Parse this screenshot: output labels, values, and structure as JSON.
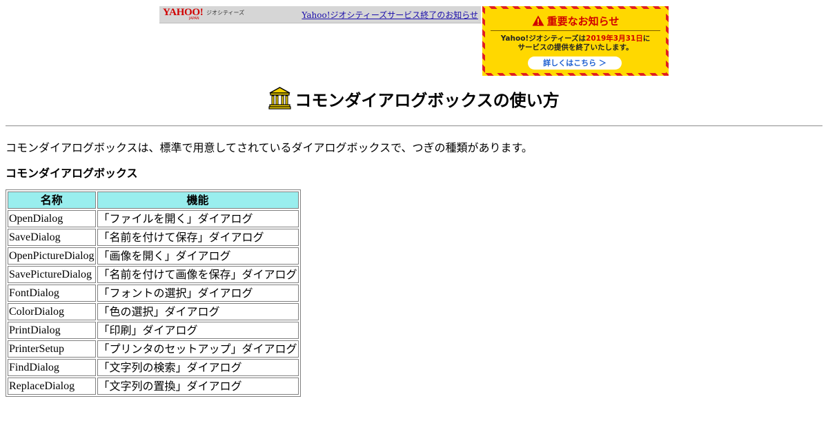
{
  "geocities_bar": {
    "logo_text": "YAHOO!",
    "logo_sub": "JAPAN",
    "service_name": "ジオシティーズ",
    "link_label": "Yahoo!ジオシティーズサービス終了のお知らせ"
  },
  "notice": {
    "title": "重要なお知らせ",
    "line1_prefix": "Yahoo!ジオシティーズは",
    "line1_date": "2019年3月31日",
    "line1_suffix": "に",
    "line2": "サービスの提供を終了いたします。",
    "button_label": "詳しくはこちら ＞",
    "colors": {
      "stripe_yellow": "#ffdc00",
      "stripe_red": "#e02020",
      "title_red": "#d00000"
    }
  },
  "page": {
    "title": "コモンダイアログボックスの使い方",
    "intro": "コモンダイアログボックスは、標準で用意してされているダイアログボックスで、つぎの種類があります。",
    "section_heading": "コモンダイアログボックス"
  },
  "table": {
    "headers": [
      "名称",
      "機能"
    ],
    "rows": [
      [
        "OpenDialog",
        "「ファイルを開く」ダイアログ"
      ],
      [
        "SaveDialog",
        "「名前を付けて保存」ダイアログ"
      ],
      [
        "OpenPictureDialog",
        "「画像を開く」ダイアログ"
      ],
      [
        "SavePictureDialog",
        "「名前を付けて画像を保存」ダイアログ"
      ],
      [
        "FontDialog",
        "「フォントの選択」ダイアログ"
      ],
      [
        "ColorDialog",
        "「色の選択」ダイアログ"
      ],
      [
        "PrintDialog",
        "「印刷」ダイアログ"
      ],
      [
        "PrinterSetup",
        "「プリンタのセットアップ」ダイアログ"
      ],
      [
        "FindDialog",
        "「文字列の検索」ダイアログ"
      ],
      [
        "ReplaceDialog",
        "「文字列の置換」ダイアログ"
      ]
    ],
    "header_color": "#99eeee"
  },
  "icons": {
    "warning": "warning-icon",
    "bank": "bank-building-icon"
  }
}
